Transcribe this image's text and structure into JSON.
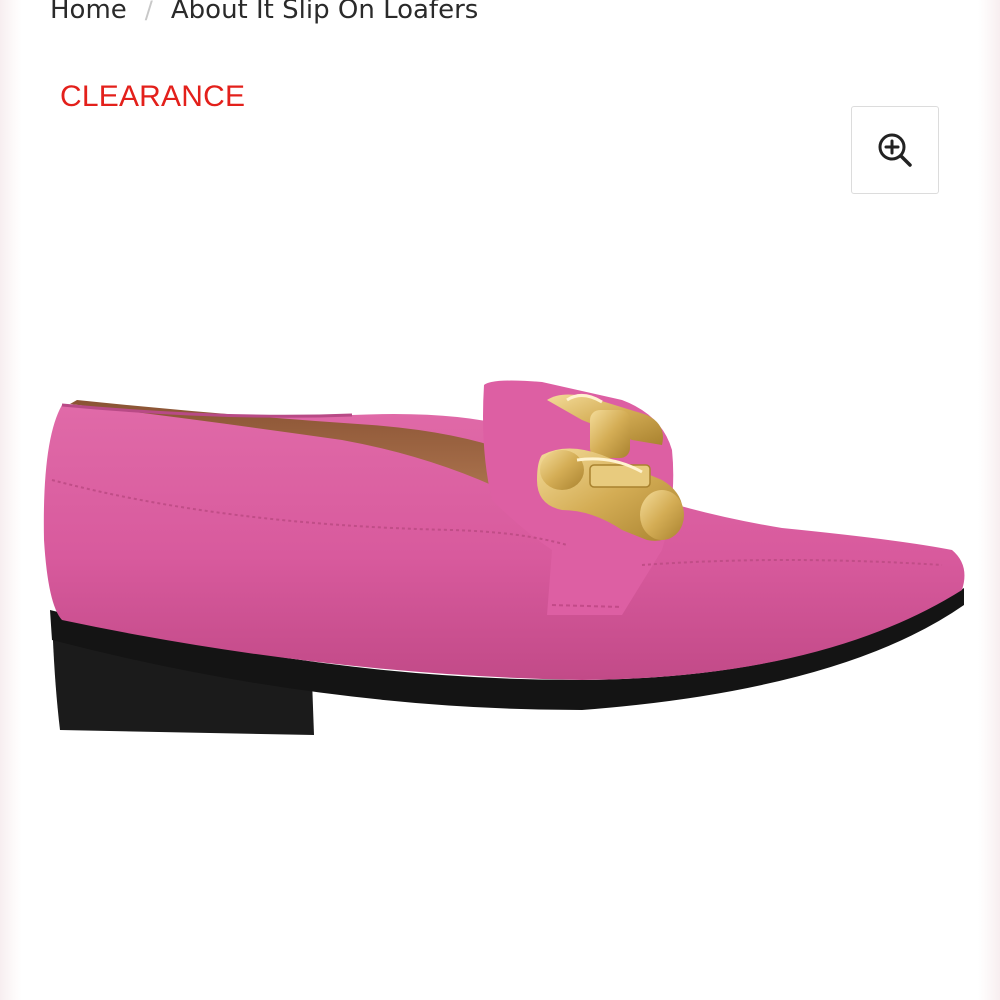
{
  "breadcrumb": {
    "home": "Home",
    "separator": "/",
    "current": "About It Slip On Loafers"
  },
  "product": {
    "badge": "CLEARANCE",
    "badge_color": "#e3201b",
    "shoe_color": "#dd5b9f",
    "hardware_color": "#d8b45a",
    "sole_color": "#1a1a1a"
  },
  "icons": {
    "zoom": "zoom-in-icon"
  }
}
